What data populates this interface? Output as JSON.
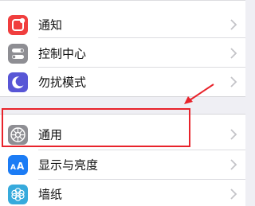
{
  "settings": {
    "items": [
      {
        "label": "通知",
        "icon": "notifications-icon",
        "color": "#f03e3e"
      },
      {
        "label": "控制中心",
        "icon": "control-center-icon",
        "color": "#8e8e93"
      },
      {
        "label": "勿扰模式",
        "icon": "do-not-disturb-icon",
        "color": "#5856d6"
      },
      {
        "label": "通用",
        "icon": "gear-icon",
        "color": "#8e8e93"
      },
      {
        "label": "显示与亮度",
        "icon": "display-brightness-icon",
        "color": "#1c7cf5"
      },
      {
        "label": "墙纸",
        "icon": "wallpaper-icon",
        "color": "#36aadc"
      }
    ]
  },
  "annotation": {
    "highlight_color": "#e8232b",
    "highlighted_item": "通用"
  }
}
